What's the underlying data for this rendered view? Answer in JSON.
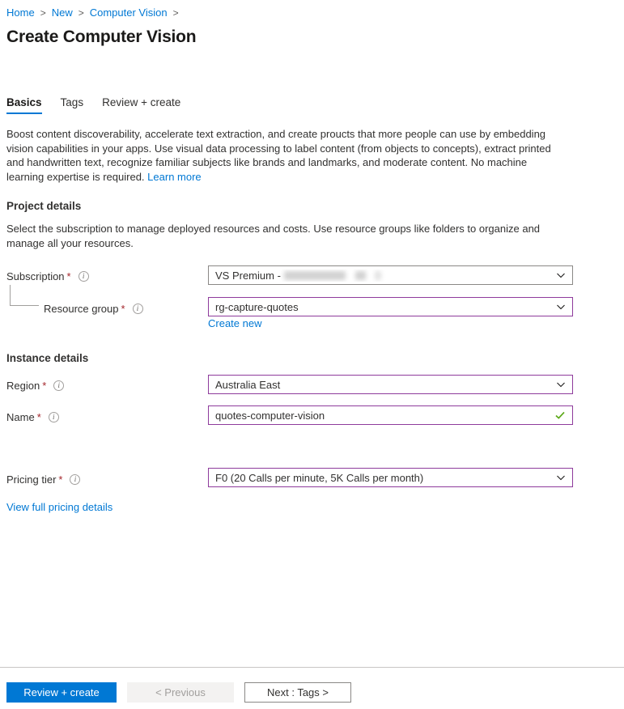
{
  "breadcrumb": {
    "items": [
      {
        "label": "Home"
      },
      {
        "label": "New"
      },
      {
        "label": "Computer Vision"
      }
    ],
    "separator": ">"
  },
  "page": {
    "title": "Create Computer Vision"
  },
  "tabs": [
    {
      "label": "Basics",
      "active": true
    },
    {
      "label": "Tags",
      "active": false
    },
    {
      "label": "Review + create",
      "active": false
    }
  ],
  "description": {
    "text": "Boost content discoverability, accelerate text extraction, and create proucts that more people can use by embedding vision capabilities in your apps. Use visual data processing to label content (from objects to concepts), extract printed and handwritten text, recognize familiar subjects like brands and landmarks, and moderate content. No machine learning expertise is required.",
    "link_label": "Learn more"
  },
  "project_details": {
    "heading": "Project details",
    "subtext": "Select the subscription to manage deployed resources and costs. Use resource groups like folders to organize and manage all your resources.",
    "subscription": {
      "label": "Subscription",
      "required_marker": "*",
      "value": "VS Premium -",
      "redacted": true
    },
    "resource_group": {
      "label": "Resource group",
      "required_marker": "*",
      "value": "rg-capture-quotes",
      "create_new_label": "Create new"
    }
  },
  "instance_details": {
    "heading": "Instance details",
    "region": {
      "label": "Region",
      "required_marker": "*",
      "value": "Australia East"
    },
    "name": {
      "label": "Name",
      "required_marker": "*",
      "value": "quotes-computer-vision",
      "valid": true
    }
  },
  "pricing": {
    "tier": {
      "label": "Pricing tier",
      "required_marker": "*",
      "value": "F0 (20 Calls per minute, 5K Calls per month)"
    },
    "details_link_label": "View full pricing details"
  },
  "footer": {
    "review_create_label": "Review + create",
    "previous_label": "< Previous",
    "next_label": "Next : Tags >"
  },
  "colors": {
    "accent_blue": "#0078d4",
    "link_blue": "#0078d4",
    "focus_purple": "#8e3b9c",
    "required_red": "#a4262c",
    "valid_green": "#5ba817",
    "border_grey": "#8a8886"
  }
}
